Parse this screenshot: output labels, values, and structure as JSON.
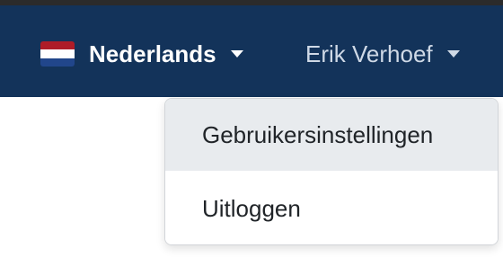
{
  "colors": {
    "navbar_background": "#13335a",
    "dropdown_highlight": "#e8ebee",
    "flag_stripes": [
      "#ae1c28",
      "#ffffff",
      "#21468b"
    ]
  },
  "navbar": {
    "language_selector": {
      "label": "Nederlands",
      "icon": "netherlands-flag-icon"
    },
    "user_menu": {
      "label": "Erik Verhoef",
      "expanded": true
    }
  },
  "user_dropdown": {
    "items": [
      {
        "label": "Gebruikersinstellingen",
        "highlighted": true
      },
      {
        "label": "Uitloggen",
        "highlighted": false
      }
    ]
  }
}
